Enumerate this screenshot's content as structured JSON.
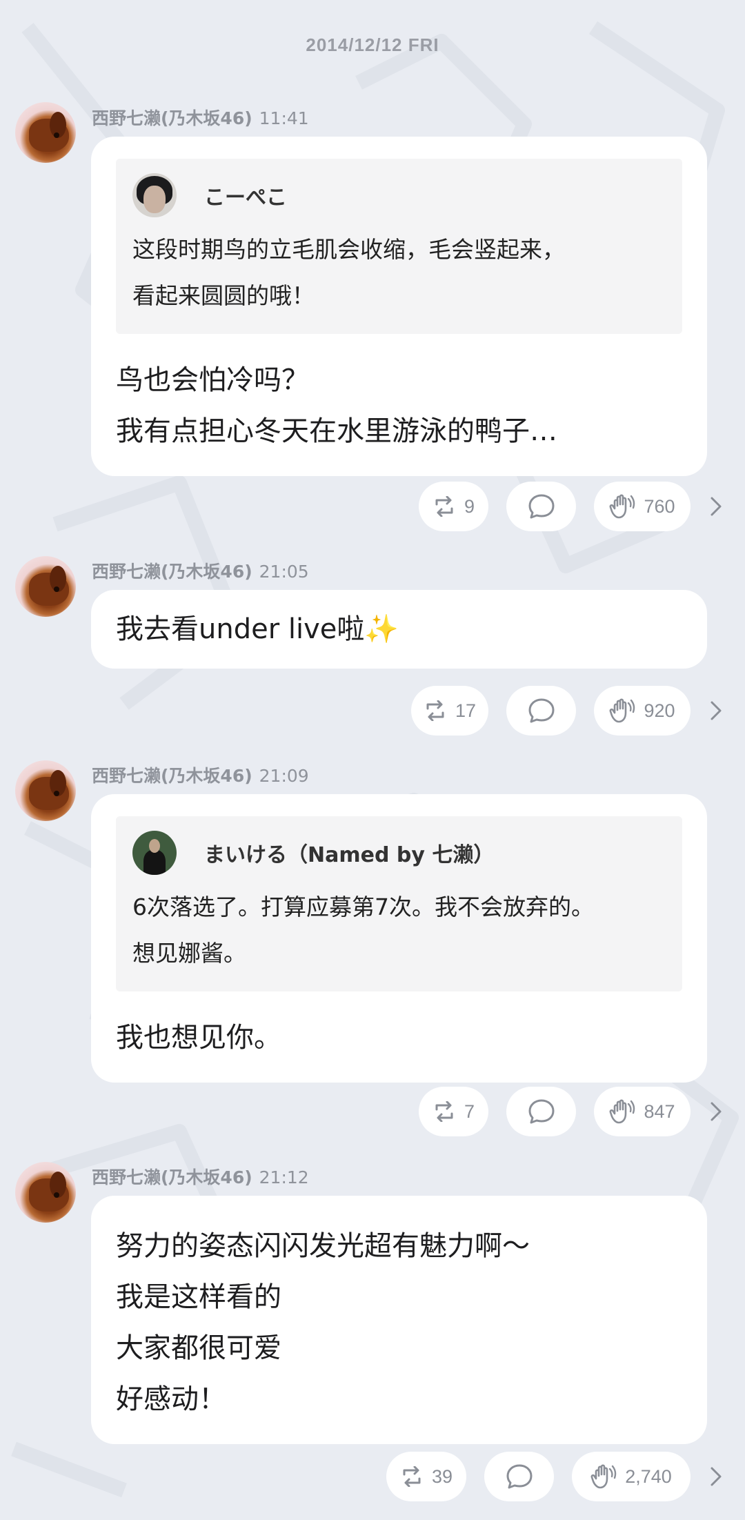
{
  "timeline": {
    "date": "2014/12/12 FRI",
    "author": "西野七濑(乃木坂46)",
    "messages": [
      {
        "time": "11:41",
        "quote": {
          "name": "こーぺこ",
          "lines": [
            "这段时期鸟的立毛肌会收缩，毛会竖起来，",
            "看起来圆圆的哦！"
          ]
        },
        "lines": [
          "鸟也会怕冷吗？",
          "我有点担心冬天在水里游泳的鸭子…"
        ],
        "repost": "9",
        "claps": "760"
      },
      {
        "time": "21:05",
        "lines": [
          "我去看under live啦✨"
        ],
        "repost": "17",
        "claps": "920"
      },
      {
        "time": "21:09",
        "quote": {
          "name": "まいける（Named by 七濑）",
          "lines": [
            "6次落选了。打算应募第7次。我不会放弃的。",
            "想见娜酱。"
          ]
        },
        "lines": [
          "我也想见你。"
        ],
        "repost": "7",
        "claps": "847"
      },
      {
        "time": "21:12",
        "lines": [
          "努力的姿态闪闪发光超有魅力啊～",
          "我是这样看的",
          "大家都很可爱",
          "好感动！"
        ],
        "repost": "39",
        "claps": "2,740"
      }
    ]
  },
  "icons": {
    "repost": "repost-icon",
    "comment": "comment-icon",
    "clap": "clap-icon",
    "more": "chevron-right-icon",
    "avatar": "dachshund-avatar"
  },
  "colors": {
    "background": "#e9ecf2",
    "bubble": "#ffffff",
    "quote": "#f4f4f5",
    "meta": "#8f939b",
    "text": "#1d1d1f"
  }
}
